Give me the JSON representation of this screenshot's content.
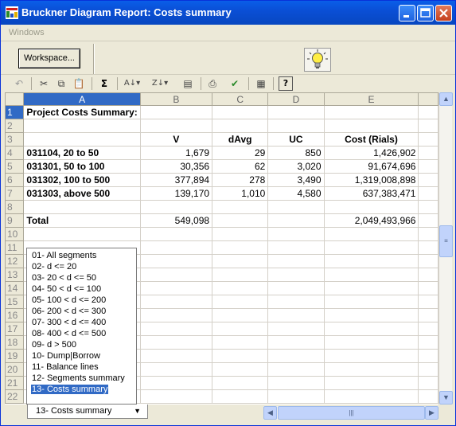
{
  "window": {
    "title": "Bruckner Diagram Report: Costs summary",
    "menu_windows": "Windows"
  },
  "panel": {
    "workspace_button": "Workspace..."
  },
  "toolbar": {
    "icons": [
      "undo-icon",
      "cut-icon",
      "copy-icon",
      "paste-icon",
      "sum-icon",
      "sort-ascending-icon",
      "sort-descending-icon",
      "properties-icon",
      "print-icon",
      "check-icon",
      "document-icon",
      "help-icon"
    ],
    "sum_label": "Σ",
    "help_label": "?"
  },
  "grid": {
    "columns": [
      "A",
      "B",
      "C",
      "D",
      "E"
    ],
    "rows": [
      {
        "num": "1",
        "cells": [
          "Project Costs Summary:",
          "",
          "",
          "",
          ""
        ]
      },
      {
        "num": "2",
        "cells": [
          "",
          "",
          "",
          "",
          ""
        ]
      },
      {
        "num": "3",
        "cells": [
          "",
          "V",
          "dAvg",
          "UC",
          "Cost (Rials)"
        ]
      },
      {
        "num": "4",
        "cells": [
          "031104, 20 to 50",
          "1,679",
          "29",
          "850",
          "1,426,902"
        ]
      },
      {
        "num": "5",
        "cells": [
          "031301, 50 to 100",
          "30,356",
          "62",
          "3,020",
          "91,674,696"
        ]
      },
      {
        "num": "6",
        "cells": [
          "031302, 100 to 500",
          "377,894",
          "278",
          "3,490",
          "1,319,008,898"
        ]
      },
      {
        "num": "7",
        "cells": [
          "031303, above 500",
          "139,170",
          "1,010",
          "4,580",
          "637,383,471"
        ]
      },
      {
        "num": "8",
        "cells": [
          "",
          "",
          "",
          "",
          ""
        ]
      },
      {
        "num": "9",
        "cells": [
          "Total",
          "549,098",
          "",
          "",
          "2,049,493,966"
        ]
      },
      {
        "num": "10",
        "cells": [
          "",
          "",
          "",
          "",
          ""
        ]
      },
      {
        "num": "11",
        "cells": [
          "",
          "",
          "",
          "",
          ""
        ]
      },
      {
        "num": "12",
        "cells": [
          "",
          "",
          "",
          "",
          ""
        ]
      },
      {
        "num": "13",
        "cells": [
          "",
          "",
          "",
          "",
          ""
        ]
      },
      {
        "num": "14",
        "cells": [
          "",
          "",
          "",
          "",
          ""
        ]
      },
      {
        "num": "15",
        "cells": [
          "",
          "",
          "",
          "",
          ""
        ]
      },
      {
        "num": "16",
        "cells": [
          "",
          "",
          "",
          "",
          ""
        ]
      },
      {
        "num": "17",
        "cells": [
          "",
          "",
          "",
          "",
          ""
        ]
      },
      {
        "num": "18",
        "cells": [
          "",
          "",
          "",
          "",
          ""
        ]
      },
      {
        "num": "19",
        "cells": [
          "",
          "",
          "",
          "",
          ""
        ]
      },
      {
        "num": "20",
        "cells": [
          "",
          "",
          "",
          "",
          ""
        ]
      },
      {
        "num": "21",
        "cells": [
          "",
          "",
          "",
          "",
          ""
        ]
      },
      {
        "num": "22",
        "cells": [
          "",
          "",
          "",
          "",
          ""
        ]
      }
    ]
  },
  "sheet_list": {
    "items": [
      "01-  All segments",
      "02-  d <= 20",
      "03-  20 < d <= 50",
      "04-  50 < d <= 100",
      "05-  100 < d <= 200",
      "06-  200 < d <= 300",
      "07-  300 < d <= 400",
      "08-  400 < d <= 500",
      "09-  d > 500",
      "10-  Dump|Borrow",
      "11-  Balance lines",
      "12-  Segments summary",
      "13-  Costs summary"
    ],
    "selected_index": 12
  },
  "sheet_tab": {
    "label": "13-  Costs summary"
  },
  "colors": {
    "title_bar": "#0a4fd6",
    "selection": "#316ac5",
    "close_button": "#c4401e"
  }
}
